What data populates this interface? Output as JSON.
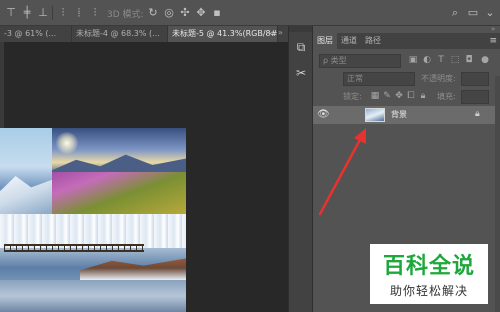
{
  "options_bar": {
    "mode_3d_label": "3D 模式:"
  },
  "document_tabs": [
    {
      "label": "-3 @ 61% (...",
      "active": false
    },
    {
      "label": "未标题-4 @ 68.3% (...",
      "active": false
    },
    {
      "label": "未标题-5 @ 41.3%(RGB/8#) *",
      "active": true
    }
  ],
  "tab_more": "»",
  "tab_close": "×",
  "layers_panel": {
    "tabs": [
      "图层",
      "通道",
      "路径"
    ],
    "menu_icon": "≡",
    "collapse_icon": "»",
    "filter_kind": "ρ 类型",
    "blend_mode": "正常",
    "opacity_label": "不透明度:",
    "lock_label": "锁定:",
    "fill_label": "填充:",
    "layer": {
      "name": "背景",
      "visible": true,
      "locked": true
    }
  },
  "watermark": {
    "title": "百科全说",
    "subtitle": "助你轻松解决"
  },
  "colors": {
    "panel_bg": "#535353",
    "arrow": "#e8322e",
    "watermark_green": "#1ea83c"
  }
}
